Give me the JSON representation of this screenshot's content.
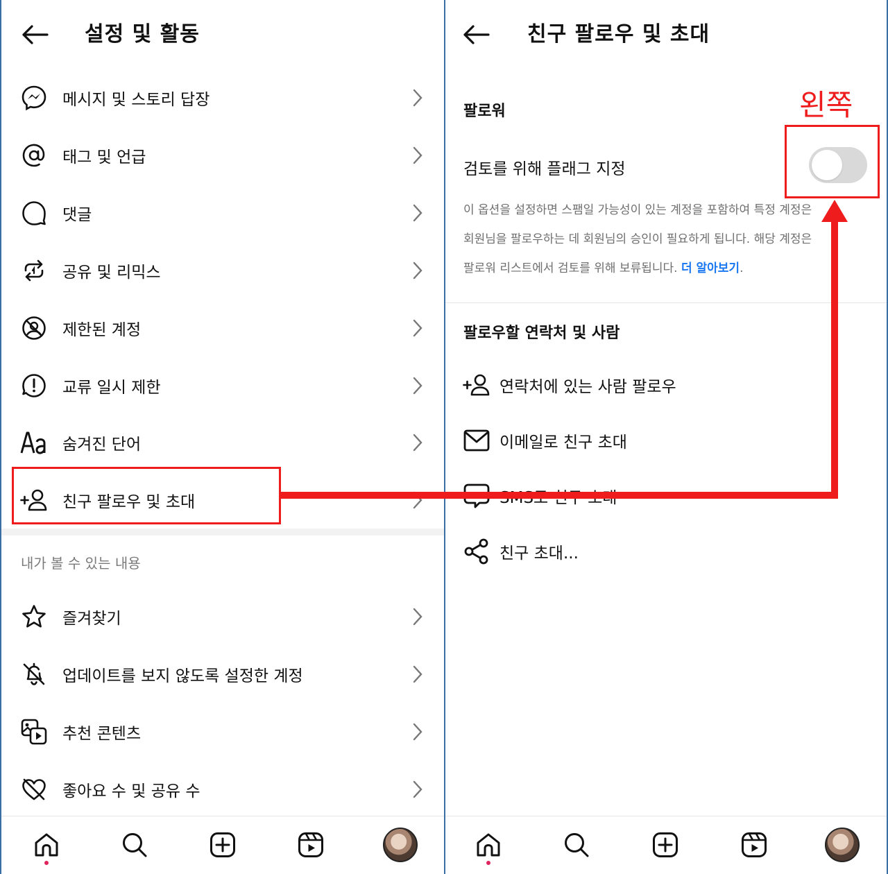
{
  "left_panel": {
    "title": "설정 및 활동",
    "items": [
      {
        "label": "메시지 및 스토리 답장",
        "icon": "messenger-icon"
      },
      {
        "label": "태그 및 언급",
        "icon": "at-sign-icon"
      },
      {
        "label": "댓글",
        "icon": "comment-icon"
      },
      {
        "label": "공유 및 리믹스",
        "icon": "repost-icon"
      },
      {
        "label": "제한된 계정",
        "icon": "restricted-account-icon"
      },
      {
        "label": "교류 일시 제한",
        "icon": "alert-circle-icon"
      },
      {
        "label": "숨겨진 단어",
        "icon": "text-aa-icon"
      },
      {
        "label": "친구 팔로우 및 초대",
        "icon": "add-person-icon"
      }
    ],
    "section_label": "내가 볼 수 있는 내용",
    "items2": [
      {
        "label": "즐겨찾기",
        "icon": "star-icon"
      },
      {
        "label": "업데이트를 보지 않도록 설정한 계정",
        "icon": "muted-bell-icon"
      },
      {
        "label": "추천 콘텐츠",
        "icon": "suggested-content-icon"
      },
      {
        "label": "좋아요 수 및 공유 수",
        "icon": "hidden-likes-icon"
      }
    ]
  },
  "right_panel": {
    "title": "친구 팔로우 및 초대",
    "followers_heading": "팔로워",
    "flag_label": "검토를 위해 플래그 지정",
    "flag_toggle_on": false,
    "description_lines": [
      "이 옵션을 설정하면 스팸일 가능성이 있는 계정을 포함하여 특정 계정은",
      "회원님을 팔로우하는 데 회원님의 승인이 필요하게 됩니다. 해당 계정은",
      "팔로워 리스트에서 검토를 위해 보류됩니다."
    ],
    "learn_more": "더 알아보기",
    "learn_more_suffix": ".",
    "contacts_heading": "팔로우할 연락처 및 사람",
    "options": [
      {
        "label": "연락처에 있는 사람 팔로우",
        "icon": "add-person-icon"
      },
      {
        "label": "이메일로 친구 초대",
        "icon": "mail-icon"
      },
      {
        "label": "SMS로 친구 초대",
        "icon": "sms-bubble-icon"
      },
      {
        "label": "친구 초대...",
        "icon": "share-icon"
      }
    ]
  },
  "annotation": {
    "text": "왼쪽",
    "color": "#ee1c1c"
  },
  "bottom_nav": [
    "home-icon",
    "search-icon",
    "create-icon",
    "reels-icon",
    "profile-avatar"
  ],
  "colors": {
    "accent_link": "#1877f2",
    "toggle_off": "#d9d9d9",
    "annotation_red": "#ee1c1c",
    "frame_border": "#3a6ea5"
  }
}
